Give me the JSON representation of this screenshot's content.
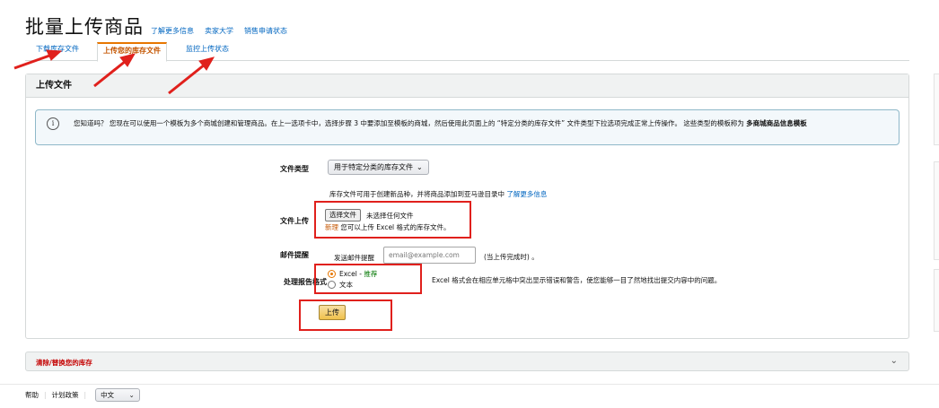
{
  "header": {
    "title": "批量上传商品",
    "links": [
      "了解更多信息",
      "卖家大学",
      "销售申请状态"
    ]
  },
  "tabs": [
    {
      "label": "下载库存文件"
    },
    {
      "label": "上传您的库存文件"
    },
    {
      "label": "监控上传状态"
    }
  ],
  "upload_panel": {
    "title": "上传文件",
    "info": {
      "text": "您知道吗？ 您现在可以使用一个模板为多个商城创建和管理商品。在上一选项卡中，选择步骤 3 中要添加至模板的商城，然后使用此页面上的 “特定分类的库存文件” 文件类型下拉选项完成正常上传操作。 这些类型的模板称为 ",
      "bold": "多商城商品信息模板"
    },
    "file_type": {
      "label": "文件类型",
      "value": "用于特定分类的库存文件",
      "help": "库存文件可用于创建新品种，并将商品添加到亚马逊目录中",
      "help_link": "了解更多信息"
    },
    "file_upload": {
      "label": "文件上传",
      "button": "选择文件",
      "status": "未选择任何文件",
      "new_tag": "新理",
      "note": "您可以上传 Excel 格式的库存文件。"
    },
    "email": {
      "label": "邮件提醒",
      "prefix": "发送邮件提醒",
      "placeholder": "email@example.com",
      "suffix": "(当上传完成时) 。"
    },
    "report_format": {
      "label": "处理报告格式",
      "options": [
        {
          "label": "Excel",
          "tag": "推荐",
          "checked": true
        },
        {
          "label": "文本",
          "checked": false
        }
      ],
      "help": "Excel 格式会在相应单元格中突出显示错误和警告，使您能够一目了然地找出提交内容中的问题。"
    },
    "upload_button": "上传"
  },
  "collapse": {
    "title": "清除/替换您的库存"
  },
  "footer": {
    "help": "帮助",
    "policy": "计划政策",
    "language": "中文"
  },
  "colors": {
    "annotation_red": "#e0201c",
    "active_tab": "#c45500",
    "link": "#0066c0"
  }
}
